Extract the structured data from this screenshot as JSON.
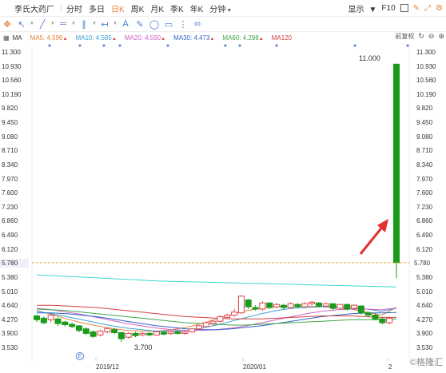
{
  "topbar": {
    "stock_name": "李氏大药厂",
    "tabs": [
      {
        "label": "分时",
        "active": false,
        "has_caret": false
      },
      {
        "label": "多日",
        "active": false,
        "has_caret": false
      },
      {
        "label": "日K",
        "active": true,
        "has_caret": false
      },
      {
        "label": "周K",
        "active": false,
        "has_caret": false
      },
      {
        "label": "月K",
        "active": false,
        "has_caret": false
      },
      {
        "label": "季K",
        "active": false,
        "has_caret": false
      },
      {
        "label": "年K",
        "active": false,
        "has_caret": false
      },
      {
        "label": "分钟",
        "active": false,
        "has_caret": true
      }
    ],
    "display_label": "显示",
    "fit_label": "F10"
  },
  "toolbar": {
    "icons": [
      "crosshair-icon",
      "cursor-icon",
      "trendline-icon",
      "hline-icon",
      "parallel-icon",
      "arrow-icon",
      "text-icon",
      "pen-icon",
      "ellipse-icon",
      "rect-icon",
      "fibonacci-icon",
      "link-icon"
    ]
  },
  "ma_legend": {
    "indicator": "MA",
    "items": [
      {
        "label": "MA5: 4.596",
        "color": "#e5823a",
        "arrow": "▲"
      },
      {
        "label": "MA10: 4.585",
        "color": "#3ea0d8",
        "arrow": "▲"
      },
      {
        "label": "MA20: 4.590",
        "color": "#d060c0",
        "arrow": "▲"
      },
      {
        "label": "MA30: 4.473",
        "color": "#2f65c8",
        "arrow": "▲"
      },
      {
        "label": "MA60: 4.298",
        "color": "#3fa84a",
        "arrow": "▲"
      },
      {
        "label": "MA120",
        "color": "#d04040",
        "arrow": ""
      }
    ],
    "adjust_label": "前复权"
  },
  "colors": {
    "up": "#e0454b",
    "down": "#1b9a1b",
    "ma5": "#e5823a",
    "ma10": "#3ea0d8",
    "ma20": "#d060c0",
    "ma30": "#2f65c8",
    "ma60": "#3fa84a",
    "ma120": "#d04040",
    "ma250": "#40d8d0",
    "current_line": "#e5a33a",
    "arrow": "#e03030"
  },
  "chart_data": {
    "type": "candlestick",
    "ylim": [
      3.53,
      11.3
    ],
    "y_ticks": [
      "11.300",
      "10.930",
      "10.560",
      "10.190",
      "9.820",
      "9.450",
      "9.080",
      "8.710",
      "8.340",
      "7.970",
      "7.600",
      "7.230",
      "6.860",
      "6.490",
      "6.120",
      "5.750",
      "5.380",
      "5.010",
      "4.640",
      "4.270",
      "3.900",
      "3.530"
    ],
    "y_ticks_right": [
      "11.300",
      "10.930",
      "10.560",
      "10.190",
      "9.820",
      "9.450",
      "9.080",
      "8.710",
      "8.340",
      "7.970",
      "7.600",
      "7.230",
      "6.860",
      "6.490",
      "6.120",
      "5.750",
      "5.380",
      "5.010",
      "4.640",
      "4.270",
      "3.900",
      "3.530"
    ],
    "current_price": "5.780",
    "high_annotation": "11.000",
    "low_annotation": "3.700",
    "x_labels": [
      "2019/12",
      "2020/01",
      "2"
    ],
    "candles": [
      {
        "o": 4.38,
        "c": 4.28,
        "h": 4.42,
        "l": 4.22
      },
      {
        "o": 4.32,
        "c": 4.2,
        "h": 4.36,
        "l": 4.16
      },
      {
        "o": 4.28,
        "c": 4.4,
        "h": 4.44,
        "l": 4.22
      },
      {
        "o": 4.3,
        "c": 4.18,
        "h": 4.34,
        "l": 4.12
      },
      {
        "o": 4.22,
        "c": 4.15,
        "h": 4.25,
        "l": 4.1
      },
      {
        "o": 4.16,
        "c": 4.1,
        "h": 4.2,
        "l": 4.06
      },
      {
        "o": 4.12,
        "c": 4.0,
        "h": 4.14,
        "l": 3.95
      },
      {
        "o": 4.04,
        "c": 3.92,
        "h": 4.08,
        "l": 3.88
      },
      {
        "o": 3.96,
        "c": 3.84,
        "h": 4.0,
        "l": 3.8
      },
      {
        "o": 3.88,
        "c": 3.98,
        "h": 4.02,
        "l": 3.84
      },
      {
        "o": 3.96,
        "c": 4.05,
        "h": 4.08,
        "l": 3.92
      },
      {
        "o": 4.02,
        "c": 3.94,
        "h": 4.06,
        "l": 3.9
      },
      {
        "o": 3.94,
        "c": 3.78,
        "h": 3.96,
        "l": 3.7
      },
      {
        "o": 3.82,
        "c": 3.92,
        "h": 3.95,
        "l": 3.78
      },
      {
        "o": 3.92,
        "c": 3.86,
        "h": 3.96,
        "l": 3.82
      },
      {
        "o": 3.88,
        "c": 3.92,
        "h": 3.95,
        "l": 3.84
      },
      {
        "o": 3.92,
        "c": 3.88,
        "h": 3.96,
        "l": 3.84
      },
      {
        "o": 3.88,
        "c": 3.96,
        "h": 3.99,
        "l": 3.85
      },
      {
        "o": 3.95,
        "c": 3.9,
        "h": 3.98,
        "l": 3.87
      },
      {
        "o": 3.92,
        "c": 3.97,
        "h": 4.0,
        "l": 3.88
      },
      {
        "o": 3.96,
        "c": 3.92,
        "h": 4.0,
        "l": 3.89
      },
      {
        "o": 3.92,
        "c": 3.96,
        "h": 3.99,
        "l": 3.88
      },
      {
        "o": 3.96,
        "c": 4.04,
        "h": 4.06,
        "l": 3.94
      },
      {
        "o": 4.04,
        "c": 4.12,
        "h": 4.14,
        "l": 4.02
      },
      {
        "o": 4.1,
        "c": 4.2,
        "h": 4.22,
        "l": 4.08
      },
      {
        "o": 4.18,
        "c": 4.24,
        "h": 4.28,
        "l": 4.14
      },
      {
        "o": 4.24,
        "c": 4.36,
        "h": 4.4,
        "l": 4.2
      },
      {
        "o": 4.34,
        "c": 4.4,
        "h": 4.44,
        "l": 4.3
      },
      {
        "o": 4.4,
        "c": 4.48,
        "h": 4.56,
        "l": 4.36
      },
      {
        "o": 4.46,
        "c": 4.9,
        "h": 4.92,
        "l": 4.44
      },
      {
        "o": 4.8,
        "c": 4.62,
        "h": 4.82,
        "l": 4.56
      },
      {
        "o": 4.6,
        "c": 4.56,
        "h": 4.66,
        "l": 4.52
      },
      {
        "o": 4.56,
        "c": 4.72,
        "h": 4.76,
        "l": 4.52
      },
      {
        "o": 4.72,
        "c": 4.6,
        "h": 4.74,
        "l": 4.56
      },
      {
        "o": 4.62,
        "c": 4.68,
        "h": 4.72,
        "l": 4.58
      },
      {
        "o": 4.66,
        "c": 4.6,
        "h": 4.7,
        "l": 4.56
      },
      {
        "o": 4.6,
        "c": 4.7,
        "h": 4.74,
        "l": 4.56
      },
      {
        "o": 4.68,
        "c": 4.62,
        "h": 4.72,
        "l": 4.58
      },
      {
        "o": 4.62,
        "c": 4.7,
        "h": 4.74,
        "l": 4.6
      },
      {
        "o": 4.7,
        "c": 4.74,
        "h": 4.78,
        "l": 4.66
      },
      {
        "o": 4.72,
        "c": 4.64,
        "h": 4.74,
        "l": 4.6
      },
      {
        "o": 4.64,
        "c": 4.7,
        "h": 4.72,
        "l": 4.6
      },
      {
        "o": 4.7,
        "c": 4.58,
        "h": 4.72,
        "l": 4.54
      },
      {
        "o": 4.58,
        "c": 4.68,
        "h": 4.7,
        "l": 4.55
      },
      {
        "o": 4.68,
        "c": 4.56,
        "h": 4.7,
        "l": 4.52
      },
      {
        "o": 4.58,
        "c": 4.66,
        "h": 4.68,
        "l": 4.54
      },
      {
        "o": 4.64,
        "c": 4.46,
        "h": 4.66,
        "l": 4.42
      },
      {
        "o": 4.46,
        "c": 4.4,
        "h": 4.5,
        "l": 4.36
      },
      {
        "o": 4.4,
        "c": 4.3,
        "h": 4.44,
        "l": 4.26
      },
      {
        "o": 4.3,
        "c": 4.2,
        "h": 4.34,
        "l": 4.16
      },
      {
        "o": 4.2,
        "c": 4.32,
        "h": 4.36,
        "l": 4.16
      },
      {
        "o": 11.0,
        "c": 5.78,
        "h": 11.0,
        "l": 5.38
      }
    ],
    "ma_lines": [
      {
        "name": "MA5",
        "color": "#e5823a",
        "values": [
          4.52,
          4.42,
          4.3,
          4.2,
          4.12,
          4.05,
          4.0,
          3.98,
          3.98,
          4.02,
          4.08,
          4.18,
          4.3,
          4.42,
          4.52,
          4.58,
          4.62,
          4.64,
          4.64,
          4.62,
          4.6,
          4.56,
          4.48,
          4.4,
          4.6
        ]
      },
      {
        "name": "MA10",
        "color": "#3ea0d8",
        "values": [
          4.5,
          4.44,
          4.36,
          4.28,
          4.2,
          4.12,
          4.06,
          4.02,
          3.98,
          3.98,
          4.0,
          4.06,
          4.14,
          4.24,
          4.34,
          4.44,
          4.52,
          4.58,
          4.6,
          4.62,
          4.62,
          4.6,
          4.56,
          4.5,
          4.58
        ]
      },
      {
        "name": "MA20",
        "color": "#d060c0",
        "values": [
          4.58,
          4.54,
          4.48,
          4.42,
          4.34,
          4.26,
          4.18,
          4.12,
          4.06,
          4.02,
          4.0,
          4.0,
          4.02,
          4.06,
          4.12,
          4.2,
          4.28,
          4.36,
          4.44,
          4.5,
          4.54,
          4.56,
          4.56,
          4.54,
          4.59
        ]
      },
      {
        "name": "MA30",
        "color": "#2f65c8",
        "values": [
          4.46,
          4.46,
          4.44,
          4.4,
          4.36,
          4.3,
          4.24,
          4.18,
          4.12,
          4.08,
          4.04,
          4.02,
          4.02,
          4.04,
          4.08,
          4.12,
          4.18,
          4.24,
          4.3,
          4.36,
          4.4,
          4.44,
          4.46,
          4.46,
          4.47
        ]
      },
      {
        "name": "MA60",
        "color": "#3fa84a",
        "values": [
          4.56,
          4.54,
          4.52,
          4.48,
          4.44,
          4.4,
          4.36,
          4.32,
          4.28,
          4.24,
          4.2,
          4.18,
          4.16,
          4.14,
          4.14,
          4.16,
          4.18,
          4.2,
          4.22,
          4.24,
          4.26,
          4.28,
          4.28,
          4.28,
          4.3
        ]
      },
      {
        "name": "MA120",
        "color": "#d04040",
        "values": [
          4.66,
          4.66,
          4.64,
          4.62,
          4.6,
          4.56,
          4.52,
          4.48,
          4.44,
          4.4,
          4.36,
          4.34,
          4.32,
          4.3,
          4.3,
          4.3,
          4.32,
          4.34,
          4.36,
          4.38,
          4.38,
          4.38,
          4.36,
          4.34,
          4.34
        ]
      },
      {
        "name": "MA250",
        "color": "#40d8d0",
        "values": [
          5.46,
          5.44,
          5.42,
          5.4,
          5.38,
          5.36,
          5.34,
          5.32,
          5.3,
          5.29,
          5.28,
          5.27,
          5.26,
          5.25,
          5.24,
          5.23,
          5.22,
          5.21,
          5.2,
          5.19,
          5.18,
          5.17,
          5.16,
          5.15,
          5.14
        ]
      }
    ]
  },
  "watermark": "格隆汇"
}
